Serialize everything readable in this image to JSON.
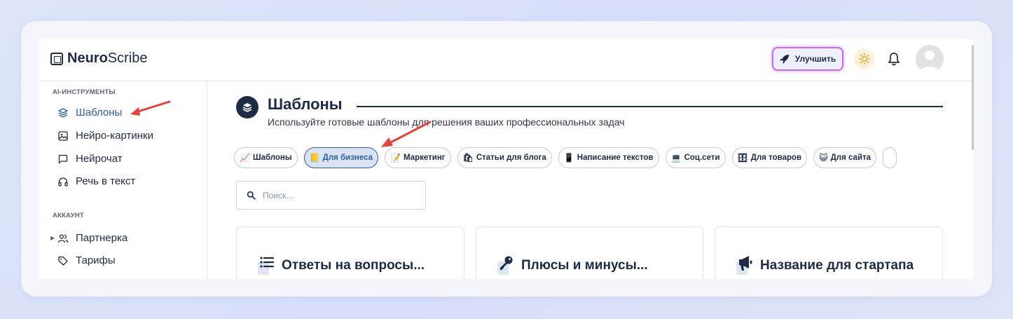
{
  "brand": {
    "name_bold": "Neuro",
    "name_rest": "Scribe"
  },
  "topbar": {
    "upgrade_label": "Улучшить"
  },
  "sidebar": {
    "sections": [
      {
        "title": "AI-ИНСТРУМЕНТЫ",
        "items": [
          {
            "label": "Шаблоны",
            "icon": "layers-icon",
            "active": true
          },
          {
            "label": "Нейро-картинки",
            "icon": "image-icon"
          },
          {
            "label": "Нейрочат",
            "icon": "chat-icon"
          },
          {
            "label": "Речь в текст",
            "icon": "headphones-icon"
          }
        ]
      },
      {
        "title": "АККАУНТ",
        "items": [
          {
            "label": "Партнерка",
            "icon": "users-icon"
          },
          {
            "label": "Тарифы",
            "icon": "tag-icon"
          }
        ]
      }
    ]
  },
  "main": {
    "title": "Шаблоны",
    "subtitle": "Используйте готовые шаблоны для решения ваших профессиональных задач",
    "chips": [
      {
        "label": "Шаблоны",
        "icon": "📈"
      },
      {
        "label": "Для бизнеса",
        "icon": "📒",
        "active": true
      },
      {
        "label": "Маркетинг",
        "icon": "📝"
      },
      {
        "label": "Статьи для блога",
        "icon": "🛍"
      },
      {
        "label": "Написание текстов",
        "icon": "📱"
      },
      {
        "label": "Соц.сети",
        "icon": "💻"
      },
      {
        "label": "Для товаров",
        "icon": "🗄"
      },
      {
        "label": "Для сайта",
        "icon": "😺"
      }
    ],
    "search_placeholder": "Поиск...",
    "cards": [
      {
        "title": "Ответы на вопросы...",
        "icon": "list-icon"
      },
      {
        "title": "Плюсы и минусы...",
        "icon": "key-icon"
      },
      {
        "title": "Название для стартапа",
        "icon": "megaphone-icon"
      }
    ]
  },
  "colors": {
    "primary": "#1d2b46",
    "accent": "#2d5fa1",
    "annotation": "#e8413a",
    "upgrade_glow": "#c46cf5"
  }
}
